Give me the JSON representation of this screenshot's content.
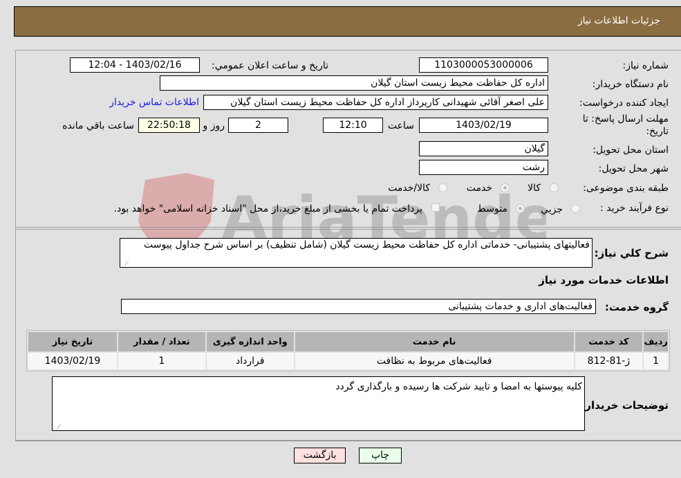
{
  "header": {
    "title": "جزئیات اطلاعات نیاز"
  },
  "form": {
    "need_number": {
      "label": "شماره نیاز:",
      "value": "1103000053000006"
    },
    "announce_datetime": {
      "label": "تاریخ و ساعت اعلان عمومي:",
      "value": "1403/02/16 - 12:04"
    },
    "buyer_org": {
      "label": "نام دستگاه خریدار:",
      "value": "اداره کل حفاظت محیط زیست استان گیلان"
    },
    "requester": {
      "label": "ایجاد کننده درخواست:",
      "value": "علی اصغر آقائی شهیدانی کارپرداز اداره کل حفاظت محیط زیست استان گیلان"
    },
    "buyer_contact_link": "اطلاعات تماس خریدار",
    "deadline": {
      "label": "مهلت ارسال پاسخ: تا تاریخ:",
      "date": "1403/02/19",
      "time_label": "ساعت",
      "time": "12:10",
      "days": "2",
      "days_label": "روز و",
      "remaining": "22:50:18",
      "remaining_label": "ساعت باقي مانده"
    },
    "delivery_province": {
      "label": "استان محل تحویل:",
      "value": "گیلان"
    },
    "delivery_city": {
      "label": "شهر محل تحویل:",
      "value": "رشت"
    },
    "category": {
      "label": "طبقه بندی موضوعی:",
      "options": [
        "کالا",
        "خدمت",
        "کالا/خدمت"
      ],
      "selected": "خدمت"
    },
    "purchase_process": {
      "label": "نوع فرآیند خرید :",
      "options": [
        "جزيي",
        "متوسط"
      ],
      "selected": "متوسط",
      "treasury_note": "پرداخت تمام یا بخشی از مبلغ خرید،از محل \"اسناد خزانه اسلامی\" خواهد بود."
    }
  },
  "description": {
    "label": "شرح کلي نیاز:",
    "value": "فعالیتهای پشتیبانی- خدماتی اداره کل  حفاظت محیط زیست گیلان (شامل تنظیف)  بر اساس شرح جداول پیوست"
  },
  "services_section": {
    "title": "اطلاعات خدمات مورد نیاز",
    "group_label": "گروه خدمت:",
    "group_value": "فعالیت‌های اداری و خدمات پشتیبانی",
    "table": {
      "columns": [
        "ردیف",
        "کد خدمت",
        "نام خدمت",
        "واحد اندازه گیری",
        "تعداد / مقدار",
        "تاریخ نیاز"
      ],
      "rows": [
        [
          "1",
          "ژ-81-812",
          "فعالیت‌های مربوط به نظافت",
          "قرارداد",
          "1",
          "1403/02/19"
        ]
      ]
    }
  },
  "buyer_notes": {
    "label": "توضیحات خریدار:",
    "value": "کلیه پیوستها به امضا و تایید شرکت ها رسیده و بارگذاری گردد"
  },
  "buttons": {
    "print": "چاپ",
    "back": "بازگشت"
  },
  "watermark": {
    "text": "AriaTender.neT"
  }
}
